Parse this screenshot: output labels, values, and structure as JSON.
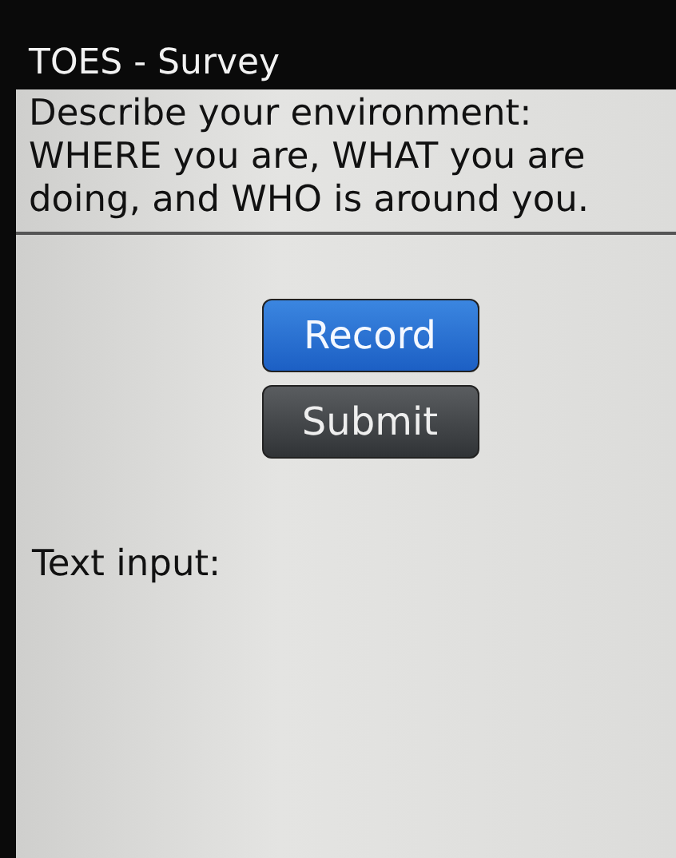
{
  "window": {
    "title": "TOES - Survey"
  },
  "prompt": "Describe your environment: WHERE you are, WHAT you are doing, and WHO is around you.",
  "buttons": [
    {
      "label": "Record",
      "kind": "primary"
    },
    {
      "label": "Submit",
      "kind": "secondary"
    }
  ],
  "text_input": {
    "label": "Text input:"
  }
}
